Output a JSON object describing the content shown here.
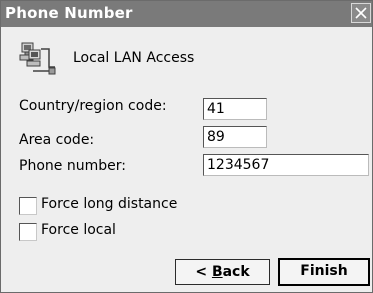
{
  "window": {
    "title": "Phone Number"
  },
  "connection": {
    "name": "Local LAN Access",
    "icon": "network-computers-icon"
  },
  "fields": {
    "country_label": "Country/region code:",
    "country_value": "41",
    "area_label": "Area code:",
    "area_value": "89",
    "phone_label": "Phone number:",
    "phone_value": "1234567"
  },
  "options": {
    "force_long_distance": "Force long distance",
    "force_local": "Force local",
    "force_long_distance_checked": false,
    "force_local_checked": false
  },
  "buttons": {
    "back_prefix": "< ",
    "back_mnemonic": "B",
    "back_rest": "ack",
    "finish": "Finish"
  },
  "icons": {
    "close": "close-icon"
  }
}
